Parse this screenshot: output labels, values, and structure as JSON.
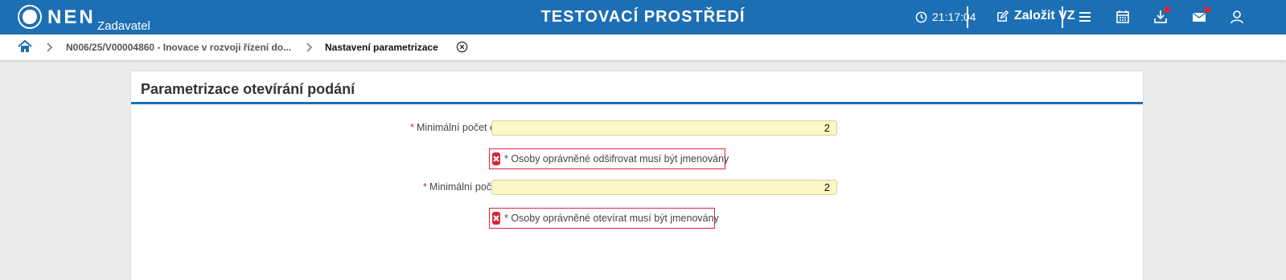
{
  "header": {
    "logo_text": "NEN",
    "logo_sub": "Zadavatel",
    "environment_title": "TESTOVACÍ PROSTŘEDÍ",
    "clock": "21:17:04",
    "create_button": "Založit VZ",
    "icons": [
      "clock-icon",
      "edit-icon",
      "menu-icon",
      "calendar-icon",
      "download-icon",
      "mail-icon",
      "user-icon"
    ],
    "accent_color": "#1d6fb4",
    "notification_color": "#d9263a"
  },
  "breadcrumb": {
    "items": [
      {
        "label": "N006/25/V00004860 - Inovace v rozvoji řízení do..."
      },
      {
        "label": "Nastavení parametrizace"
      }
    ]
  },
  "panel": {
    "title": "Parametrizace otevírání podání",
    "fields": [
      {
        "required_mark": "*",
        "label": "Minimální počet osob potřebný k odšifrování:",
        "value": "2",
        "error": "* Osoby oprávněné odšifrovat musí být jmenovány"
      },
      {
        "required_mark": "*",
        "label": "Minimální počet osob potřebný k otevření:",
        "value": "2",
        "error": "* Osoby oprávněné otevírat musí být jmenovány"
      }
    ]
  }
}
